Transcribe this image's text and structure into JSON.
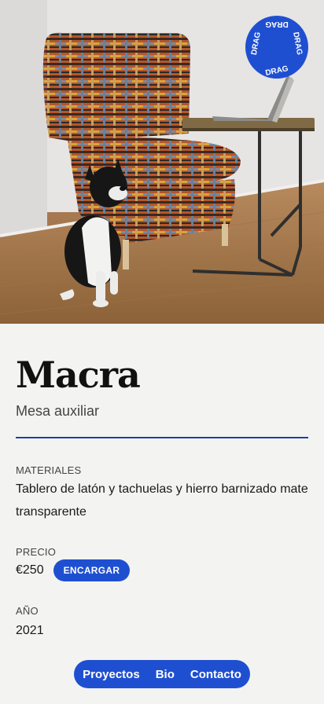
{
  "product": {
    "name": "Macra",
    "category": "Mesa auxiliar"
  },
  "badge": {
    "text": "DRAG"
  },
  "details": {
    "materials_label": "MATERIALES",
    "materials_value": "Tablero de latón y tachuelas y hierro barnizado mate transparente",
    "price_label": "PRECIO",
    "price_value": "€250",
    "order_label": "ENCARGAR",
    "year_label": "AÑO",
    "year_value": "2021"
  },
  "nav": {
    "items": [
      {
        "label": "Proyectos"
      },
      {
        "label": "Bio"
      },
      {
        "label": "Contacto"
      }
    ]
  },
  "colors": {
    "accent": "#1f4fd1",
    "divider": "#1f3fa8",
    "background": "#f3f3f2"
  }
}
